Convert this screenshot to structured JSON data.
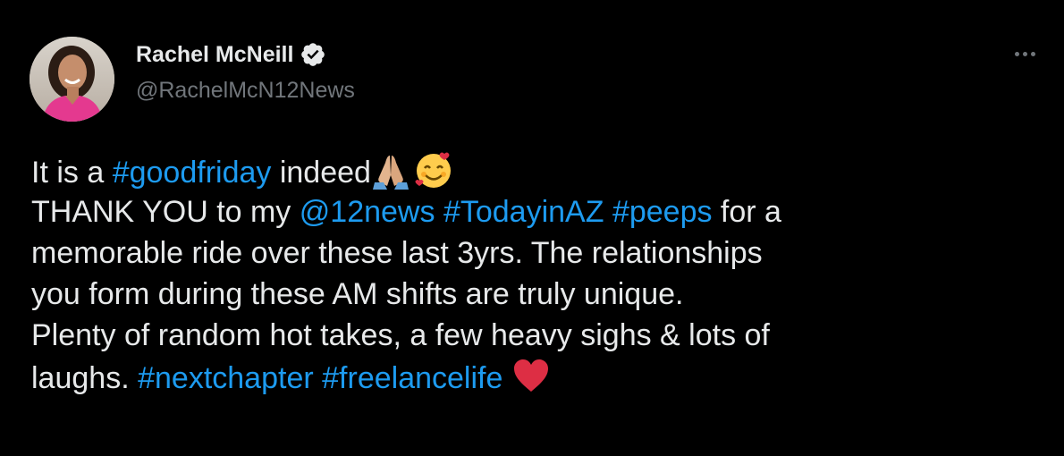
{
  "author": {
    "display_name": "Rachel McNeill",
    "handle": "@RachelMcN12News",
    "verified": true
  },
  "icons": {
    "verified": "verified-badge-icon",
    "more": "more-options-icon",
    "emoji_1": "folded-hands-emoji-icon",
    "emoji_2": "smiling-face-with-hearts-emoji-icon",
    "emoji_3": "red-heart-emoji-icon"
  },
  "colors": {
    "background": "#000000",
    "text": "#e7e9ea",
    "muted": "#71767b",
    "link": "#1d9bf0",
    "verified_badge": "#e7e9ea"
  },
  "tweet": {
    "line1": {
      "t1": "It is a ",
      "tag_goodfriday": "#goodfriday",
      "t2": " indeed"
    },
    "line2": {
      "t1": "THANK YOU to my ",
      "mention_12news": "@12news",
      "t2": " ",
      "tag_todayinaz": "#TodayinAZ",
      "t3": " ",
      "tag_peeps": "#peeps",
      "t4": " for a"
    },
    "line3": "memorable ride over these last 3yrs. The relationships",
    "line4": "you form during these AM shifts are truly unique.",
    "line5": "Plenty of random hot takes, a few heavy sighs & lots of",
    "line6": {
      "t1": "laughs. ",
      "tag_nextchapter": "#nextchapter",
      "t2": " ",
      "tag_freelancelife": "#freelancelife",
      "t3": " "
    }
  }
}
